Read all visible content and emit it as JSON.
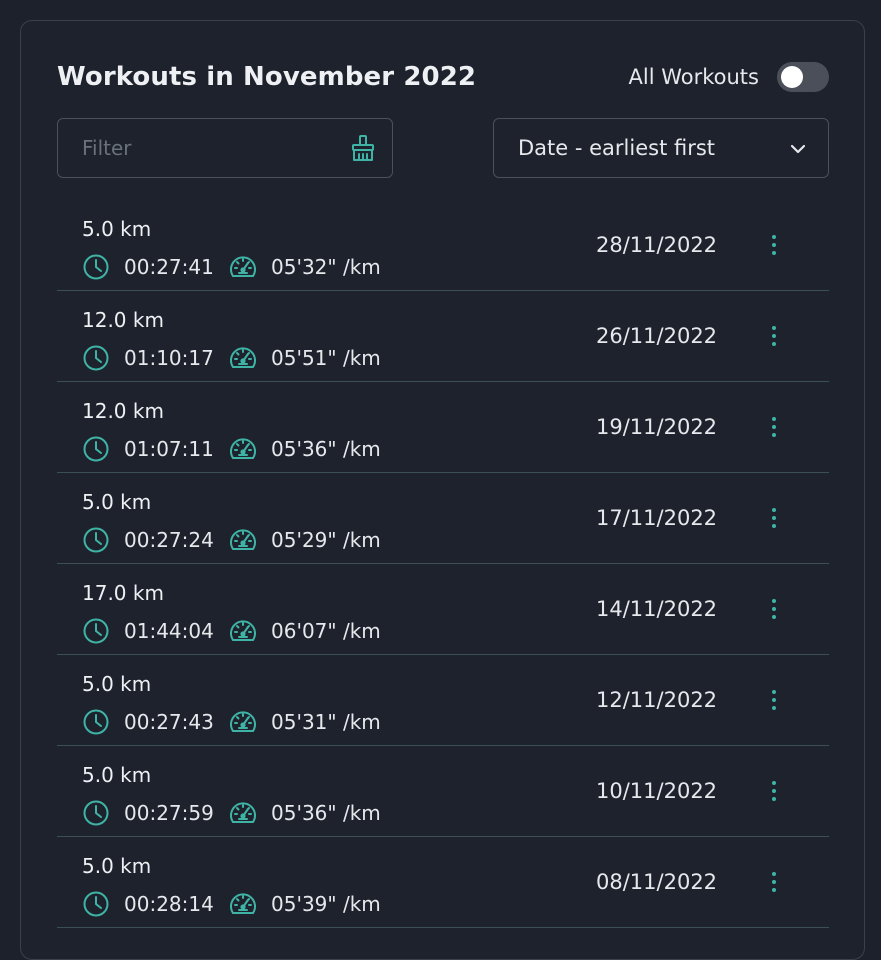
{
  "header": {
    "title": "Workouts in November 2022",
    "toggle_label": "All Workouts",
    "toggle_on": false
  },
  "filter": {
    "placeholder": "Filter",
    "value": "",
    "clear_icon": "broom-icon"
  },
  "sort": {
    "selected": "Date - earliest first",
    "icon": "chevron-down-icon"
  },
  "colors": {
    "accent": "#3fb4a6",
    "background": "#1e222d",
    "divider": "#3b4f55"
  },
  "workouts": [
    {
      "distance": "5.0 km",
      "duration": "00:27:41",
      "pace": "05'32\" /km",
      "date": "28/11/2022"
    },
    {
      "distance": "12.0 km",
      "duration": "01:10:17",
      "pace": "05'51\" /km",
      "date": "26/11/2022"
    },
    {
      "distance": "12.0 km",
      "duration": "01:07:11",
      "pace": "05'36\" /km",
      "date": "19/11/2022"
    },
    {
      "distance": "5.0 km",
      "duration": "00:27:24",
      "pace": "05'29\" /km",
      "date": "17/11/2022"
    },
    {
      "distance": "17.0 km",
      "duration": "01:44:04",
      "pace": "06'07\" /km",
      "date": "14/11/2022"
    },
    {
      "distance": "5.0 km",
      "duration": "00:27:43",
      "pace": "05'31\" /km",
      "date": "12/11/2022"
    },
    {
      "distance": "5.0 km",
      "duration": "00:27:59",
      "pace": "05'36\" /km",
      "date": "10/11/2022"
    },
    {
      "distance": "5.0 km",
      "duration": "00:28:14",
      "pace": "05'39\" /km",
      "date": "08/11/2022"
    }
  ]
}
